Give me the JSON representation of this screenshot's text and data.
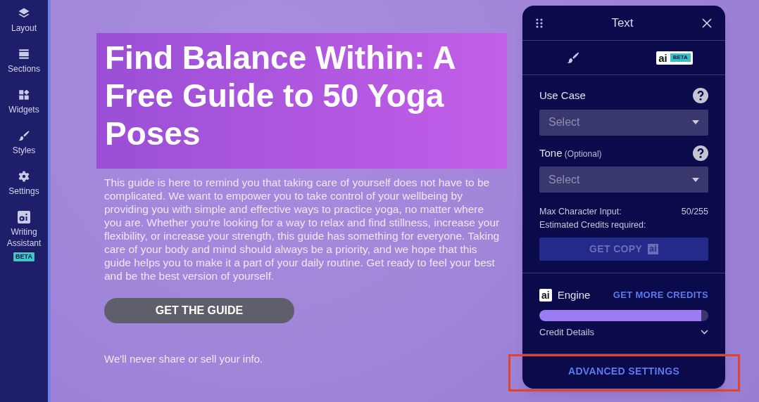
{
  "sidebar": {
    "items": [
      {
        "kind": "layers",
        "label": "Layout"
      },
      {
        "kind": "sections",
        "label": "Sections"
      },
      {
        "kind": "widgets",
        "label": "Widgets"
      },
      {
        "kind": "brush",
        "label": "Styles"
      },
      {
        "kind": "gear",
        "label": "Settings"
      },
      {
        "kind": "ai",
        "label": "Writing Assistant",
        "badge": "BETA"
      }
    ]
  },
  "canvas": {
    "heading": "Find Balance Within: A Free Guide to 50 Yoga Poses",
    "body": "This guide is here to remind you that taking care of yourself does not have to be complicated. We want to empower you to take control of your wellbeing by providing you with simple and effective ways to practice yoga, no matter where you are. Whether you're looking for a way to relax and find stillness, increase your flexibility, or increase your strength, this guide has something for everyone. Taking care of your body and mind should always be a priority, and we hope that this guide helps you to make it a part of your daily routine. Get ready to feel your best and be the best version of yourself.",
    "button": "GET THE GUIDE",
    "note": "We'll never share or sell your info."
  },
  "panel": {
    "title": "Text",
    "tabs": [
      {
        "kind": "brush"
      },
      {
        "kind": "ai",
        "label": "ai",
        "badge": "BETA"
      }
    ],
    "fields": [
      {
        "label": "Use Case",
        "placeholder": "Select"
      },
      {
        "label": "Tone",
        "hint": "(Optional)",
        "placeholder": "Select"
      }
    ],
    "max_label": "Max Character Input:",
    "max_value": "50/255",
    "credits_label": "Estimated Credits required:",
    "get_copy": "GET COPY",
    "get_copy_badge": "ai",
    "engine_badge": "ai",
    "engine_label": "Engine",
    "more_credits": "GET MORE CREDITS",
    "credit": {
      "level": 0.96
    },
    "credit_details": "Credit Details",
    "advanced": "ADVANCED SETTINGS"
  }
}
